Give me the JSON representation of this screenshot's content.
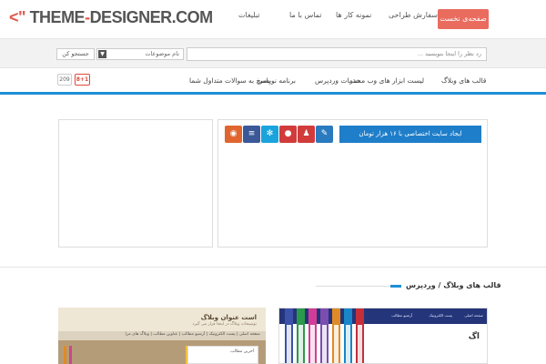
{
  "header": {
    "logo": {
      "prefix": "<\"",
      "part1": "THEME",
      "dash": "-",
      "part2": "DESIGNER.COM"
    },
    "nav": [
      "صفحه‌ی نخست",
      "سفارش طراحی",
      "نمونه کار ها",
      "تماس با ما",
      "تبلیغات"
    ]
  },
  "search": {
    "input_value": "رد نظر را اینجا بنویسید ...",
    "select_value": "نام موضوعات",
    "button_label": "جستجو کن"
  },
  "categories": [
    "قالب های وبلاگ",
    "لیست ابزار های وب مستر",
    "خدمات وردپرس",
    "برنامه نویسی",
    "پاسخ به سوالات متداول شما"
  ],
  "social": {
    "count": "209",
    "gplus": "8+1"
  },
  "banner": {
    "label": "ایجاد سایت اختصاصی با ۱۶ هزار تومان"
  },
  "share_colors": [
    "#e0652e",
    "#3b5998",
    "#1aa3dc",
    "#d23b3b",
    "#d23b3b",
    "#2a7ac0"
  ],
  "share_icons": [
    "rss-icon",
    "layers-icon",
    "gear-icon",
    "microphone-icon",
    "user-icon",
    "edit-icon"
  ],
  "section": {
    "title": "قالب های وبلاگ / وردپرس"
  },
  "thumb_left": {
    "title": "است عنوان وبلاگ",
    "subtitle": "توضیحات وبلاگ در اینجا قرار می گیرد",
    "nav": "صفحه اصلی  |  پست الکترونیک  |  آرشیو مطالب  |  عناوین مطالب  |  وبلاگ های مرا",
    "card_text": "آخرین مطالب"
  },
  "thumb_right": {
    "bar_items": [
      "صفحه اصلی",
      "پست الکترونیک",
      "آرشیو مطالب"
    ],
    "big_text": "اگ"
  },
  "thumb_right_strip_colors": [
    "#3b52a8",
    "#2b9a4b",
    "#d33c96",
    "#7b4db0",
    "#e08a26",
    "#1a86c8",
    "#c62f3a"
  ]
}
